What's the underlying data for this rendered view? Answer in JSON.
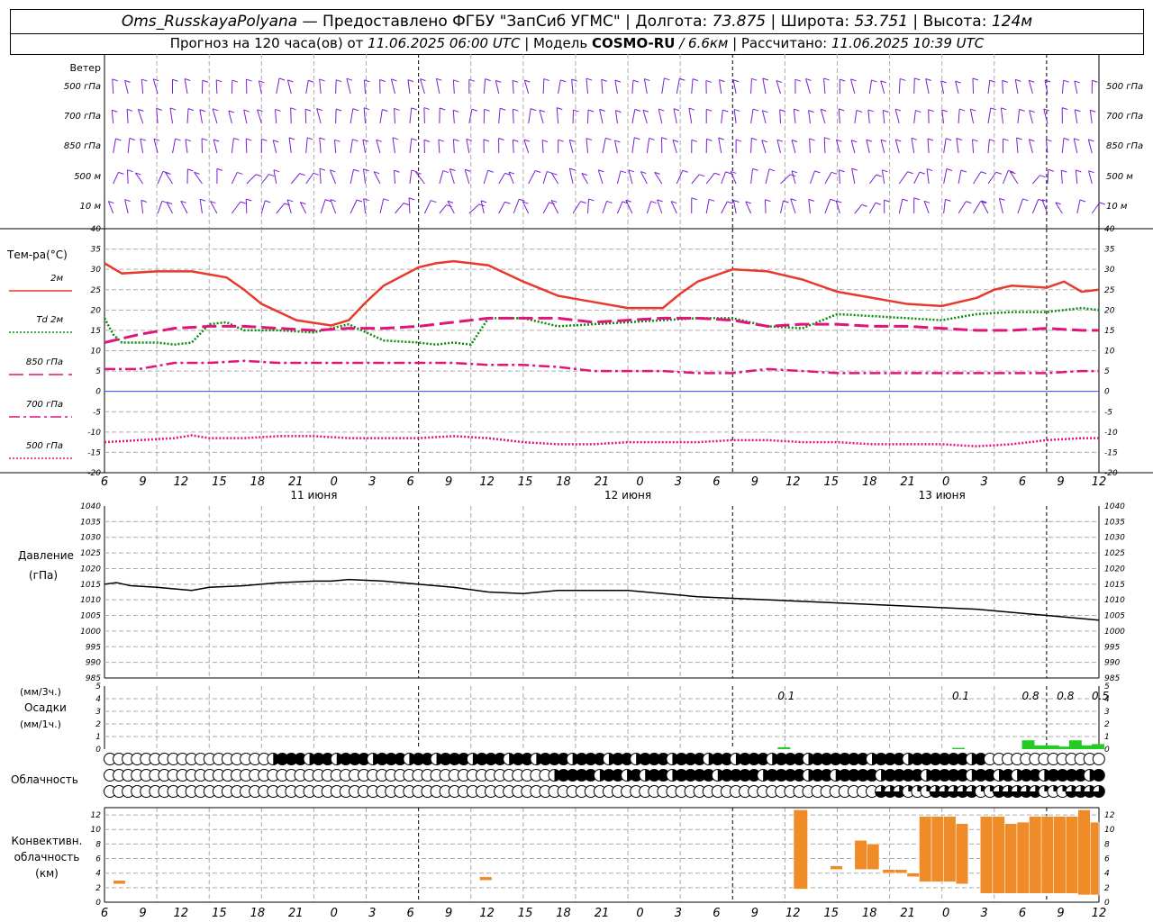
{
  "header": {
    "station": "Oms_RusskayaPolyana",
    "provided_by": "Предоставлено ФГБУ \"ЗапСиб УГМС\"",
    "lon_label": "Долгота:",
    "lon": "73.875",
    "lat_label": "Широта:",
    "lat": "53.751",
    "alt_label": "Высота:",
    "alt": "124м",
    "forecast_label": "Прогноз на 120 часа(ов) от",
    "forecast_time": "11.06.2025 06:00 UTC",
    "model_label": "Модель",
    "model": "COSMO-RU",
    "model_res": "/ 6.6км",
    "calc_label": "Рассчитано:",
    "calc_time": "11.06.2025 10:39 UTC",
    "dash": "—"
  },
  "chart_data": [
    {
      "type": "barbs",
      "title": "Ветер",
      "levels": [
        "500 гПа",
        "700 гПа",
        "850 гПа",
        "500 м",
        "10 м"
      ],
      "x_hours": [
        0,
        57
      ],
      "note_color": "#7b1fd0"
    },
    {
      "type": "line",
      "title": "Тем-ра(°C)",
      "ylim": [
        -20,
        40
      ],
      "yticks": [
        -20,
        -15,
        -10,
        -5,
        0,
        5,
        10,
        15,
        20,
        25,
        30,
        35,
        40
      ],
      "x_ticks_hours": [
        "6",
        "9",
        "12",
        "15",
        "18",
        "21",
        "0",
        "3",
        "6",
        "9",
        "12",
        "15",
        "18",
        "21",
        "0",
        "3",
        "6",
        "9",
        "12",
        "15",
        "18",
        "21",
        "0",
        "3",
        "6",
        "9",
        "12"
      ],
      "days": [
        "11 июня",
        "12 июня",
        "13 июня"
      ],
      "series": [
        {
          "name": "2м",
          "color": "#e8392d",
          "style": "solid",
          "x": [
            0,
            1,
            3,
            5,
            7,
            8,
            9,
            11,
            13,
            14,
            15,
            16,
            18,
            19,
            20,
            22,
            24,
            26,
            28,
            30,
            32,
            33,
            34,
            36,
            38,
            40,
            42,
            44,
            46,
            48,
            50,
            51,
            52,
            54,
            55,
            56,
            57
          ],
          "values": [
            31.5,
            29,
            29.5,
            29.5,
            28,
            25,
            21.5,
            17.5,
            16.2,
            17.5,
            22,
            26,
            30.5,
            31.5,
            32,
            31,
            27,
            23.5,
            22,
            20.5,
            20.5,
            24,
            27,
            30,
            29.5,
            27.5,
            24.5,
            23,
            21.5,
            21,
            23,
            25,
            26,
            25.5,
            27,
            24.5,
            25
          ]
        },
        {
          "name": "Td 2м",
          "color": "#0a8a0a",
          "style": "dot",
          "x": [
            0,
            0.5,
            1,
            3,
            4,
            5,
            6,
            7,
            8,
            10,
            12,
            14,
            16,
            18,
            19,
            20,
            21,
            22,
            24,
            26,
            28,
            30,
            32,
            34,
            36,
            38,
            40,
            42,
            44,
            46,
            48,
            50,
            52,
            54,
            56,
            57
          ],
          "values": [
            18,
            14,
            12,
            12,
            11.5,
            12,
            16.5,
            17,
            15,
            15,
            14.5,
            16.5,
            12.5,
            12,
            11.5,
            12,
            11.5,
            18,
            18,
            16,
            16.5,
            17,
            17.5,
            18,
            18,
            16,
            15.5,
            19,
            18.5,
            18,
            17.5,
            19,
            19.5,
            19.5,
            20.5,
            20
          ]
        },
        {
          "name": "850 гПа",
          "color": "#e0147a",
          "style": "longdash",
          "x": [
            0,
            2,
            4,
            6,
            8,
            10,
            12,
            14,
            16,
            18,
            20,
            22,
            24,
            26,
            28,
            30,
            32,
            34,
            36,
            38,
            40,
            42,
            44,
            46,
            48,
            50,
            52,
            54,
            56,
            57
          ],
          "values": [
            12,
            14,
            15.5,
            16,
            16,
            15.5,
            15,
            15.5,
            15.5,
            16,
            17,
            18,
            18,
            18,
            17,
            17.5,
            18,
            18,
            17.5,
            16,
            16.5,
            16.5,
            16,
            16,
            15.5,
            15,
            15,
            15.5,
            15,
            15
          ]
        },
        {
          "name": "700 гПа",
          "color": "#e0147a",
          "style": "dashdot",
          "x": [
            0,
            2,
            4,
            6,
            8,
            10,
            12,
            14,
            16,
            18,
            20,
            22,
            24,
            26,
            28,
            30,
            32,
            34,
            36,
            38,
            40,
            42,
            44,
            46,
            48,
            50,
            52,
            54,
            56,
            57
          ],
          "values": [
            5.5,
            5.5,
            7,
            7,
            7.5,
            7,
            7,
            7,
            7,
            7,
            7,
            6.5,
            6.5,
            6,
            5,
            5,
            5,
            4.5,
            4.5,
            5.5,
            5,
            4.5,
            4.5,
            4.5,
            4.5,
            4.5,
            4.5,
            4.5,
            5,
            5
          ]
        },
        {
          "name": "500 гПа",
          "color": "#e0147a",
          "style": "dot",
          "x": [
            0,
            2,
            4,
            5,
            6,
            8,
            10,
            12,
            14,
            16,
            18,
            20,
            22,
            24,
            26,
            28,
            30,
            32,
            34,
            36,
            38,
            40,
            42,
            44,
            46,
            48,
            50,
            52,
            54,
            56,
            57
          ],
          "values": [
            -12.5,
            -12,
            -11.5,
            -10.8,
            -11.5,
            -11.5,
            -11,
            -11,
            -11.5,
            -11.5,
            -11.5,
            -11,
            -11.5,
            -12.5,
            -13,
            -13,
            -12.5,
            -12.5,
            -12.5,
            -12,
            -12,
            -12.5,
            -12.5,
            -13,
            -13,
            -13,
            -13.5,
            -13,
            -12,
            -11.5,
            -11.5
          ]
        }
      ]
    },
    {
      "type": "line",
      "title": "Давление",
      "ylabel": "(гПа)",
      "ylim": [
        985,
        1040
      ],
      "yticks": [
        985,
        990,
        995,
        1000,
        1005,
        1010,
        1015,
        1020,
        1025,
        1030,
        1035,
        1040
      ],
      "series": [
        {
          "name": "",
          "color": "#000000",
          "x": [
            0,
            0.7,
            1.5,
            3,
            4,
            5,
            6,
            8,
            10,
            12,
            13,
            14,
            16,
            18,
            20,
            22,
            24,
            26,
            28,
            30,
            32,
            34,
            36,
            38,
            40,
            42,
            44,
            46,
            48,
            50,
            52,
            54,
            56,
            57
          ],
          "values": [
            1015,
            1015.5,
            1014.5,
            1014,
            1013.5,
            1013,
            1014,
            1014.5,
            1015.5,
            1016,
            1016,
            1016.5,
            1016,
            1015,
            1014,
            1012.5,
            1012,
            1013,
            1013,
            1013,
            1012,
            1011,
            1010.5,
            1010,
            1009.5,
            1009,
            1008.5,
            1008,
            1007.5,
            1007,
            1006,
            1005,
            1004,
            1003.5
          ]
        }
      ]
    },
    {
      "type": "bar",
      "title": "Осадки",
      "ylabel_top": "(мм/3ч.)",
      "ylabel_bottom": "(мм/1ч.)",
      "ylim": [
        0,
        5
      ],
      "yticks": [
        0,
        1,
        2,
        3,
        4,
        5
      ],
      "labels": [
        {
          "x": 39,
          "text": "0.1"
        },
        {
          "x": 49,
          "text": "0.1"
        },
        {
          "x": 53,
          "text": "0.8"
        },
        {
          "x": 55,
          "text": "0.8"
        },
        {
          "x": 57,
          "text": "0.5"
        }
      ],
      "bars": [
        {
          "x": 39,
          "value": 0.15
        },
        {
          "x": 49,
          "value": 0.1
        },
        {
          "x": 53,
          "value": 0.7
        },
        {
          "x": 53.7,
          "value": 0.3
        },
        {
          "x": 54.4,
          "value": 0.3
        },
        {
          "x": 55,
          "value": 0.2
        },
        {
          "x": 55.7,
          "value": 0.7
        },
        {
          "x": 56.3,
          "value": 0.3
        },
        {
          "x": 57,
          "value": 0.4
        }
      ],
      "color": "#22cc22"
    },
    {
      "type": "cloud-symbols",
      "title": "Облачность",
      "rows": 3
    },
    {
      "type": "bar",
      "title": "Конвективн. облачность (км)",
      "label_lines": [
        "Конвективн.",
        "облачность",
        "(км)"
      ],
      "ylim": [
        0,
        13
      ],
      "yticks": [
        0,
        2,
        4,
        6,
        8,
        10,
        12
      ],
      "color": "#f08c28",
      "bars": [
        {
          "x0": 0.5,
          "x1": 1.2,
          "bottom": 2.5,
          "top": 3
        },
        {
          "x0": 21.5,
          "x1": 22.2,
          "bottom": 3,
          "top": 3.5
        },
        {
          "x0": 39.5,
          "x1": 40.3,
          "bottom": 1.8,
          "top": 12.7
        },
        {
          "x0": 41.6,
          "x1": 42.3,
          "bottom": 4.5,
          "top": 5
        },
        {
          "x0": 43.0,
          "x1": 43.7,
          "bottom": 4.5,
          "top": 8.5
        },
        {
          "x0": 43.7,
          "x1": 44.4,
          "bottom": 4.5,
          "top": 8.0
        },
        {
          "x0": 44.6,
          "x1": 45.3,
          "bottom": 4,
          "top": 4.5
        },
        {
          "x0": 45.3,
          "x1": 46.0,
          "bottom": 4,
          "top": 4.5
        },
        {
          "x0": 46.0,
          "x1": 46.7,
          "bottom": 3.5,
          "top": 4
        },
        {
          "x0": 46.7,
          "x1": 47.4,
          "bottom": 2.8,
          "top": 11.8
        },
        {
          "x0": 47.4,
          "x1": 48.1,
          "bottom": 2.8,
          "top": 11.8
        },
        {
          "x0": 48.1,
          "x1": 48.8,
          "bottom": 2.8,
          "top": 11.8
        },
        {
          "x0": 48.8,
          "x1": 49.5,
          "bottom": 2.5,
          "top": 10.8
        },
        {
          "x0": 50.2,
          "x1": 50.9,
          "bottom": 1.2,
          "top": 11.8
        },
        {
          "x0": 50.9,
          "x1": 51.6,
          "bottom": 1.2,
          "top": 11.8
        },
        {
          "x0": 51.6,
          "x1": 52.3,
          "bottom": 1.2,
          "top": 10.8
        },
        {
          "x0": 52.3,
          "x1": 53.0,
          "bottom": 1.2,
          "top": 11
        },
        {
          "x0": 53.0,
          "x1": 53.7,
          "bottom": 1.2,
          "top": 11.8
        },
        {
          "x0": 53.7,
          "x1": 54.4,
          "bottom": 1.2,
          "top": 11.8
        },
        {
          "x0": 54.4,
          "x1": 55.1,
          "bottom": 1.2,
          "top": 11.8
        },
        {
          "x0": 55.1,
          "x1": 55.8,
          "bottom": 1.2,
          "top": 11.8
        },
        {
          "x0": 55.8,
          "x1": 56.5,
          "bottom": 1,
          "top": 12.7
        },
        {
          "x0": 56.5,
          "x1": 57.0,
          "bottom": 1,
          "top": 11
        }
      ]
    }
  ]
}
